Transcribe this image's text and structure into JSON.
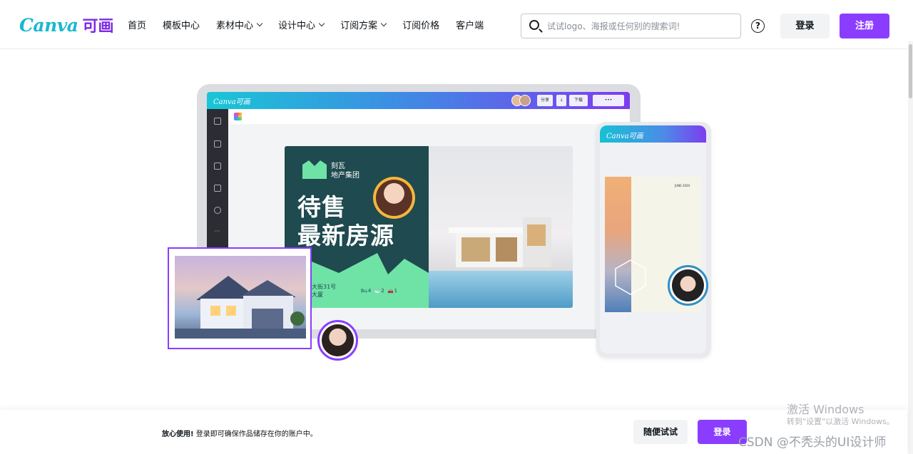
{
  "header": {
    "logo_word": "Canva",
    "logo_cn": "可画",
    "nav": [
      {
        "label": "首页",
        "dropdown": false
      },
      {
        "label": "模板中心",
        "dropdown": false
      },
      {
        "label": "素材中心",
        "dropdown": true
      },
      {
        "label": "设计中心",
        "dropdown": true
      },
      {
        "label": "订阅方案",
        "dropdown": true
      },
      {
        "label": "订阅价格",
        "dropdown": false
      },
      {
        "label": "客户端",
        "dropdown": false
      }
    ],
    "search_placeholder": "试试logo、海报或任何别的搜索词!",
    "help_icon": "?",
    "login_label": "登录",
    "register_label": "注册"
  },
  "hero": {
    "app_logo": "Canva可画",
    "app_buttons": [
      "分享",
      "↓",
      "下载",
      "•••"
    ],
    "design": {
      "brand_line1": "刻瓦",
      "brand_line2": "地产集团",
      "headline": "待售\n最新房源",
      "address": "朝阳大街31号\n万科大厦",
      "specs": "🛏4   🛁2   🚗1"
    },
    "phone_logo": "Canva可画",
    "phone_card_date": "JUNE 2020"
  },
  "bottom_bar": {
    "notice_bold": "放心使用!",
    "notice_text": "登录即可确保作品储存在你的账户中。",
    "try_label": "随便试试",
    "login_label": "登录"
  },
  "watermark": {
    "win_title": "激活 Windows",
    "win_sub": "转到\"设置\"以激活 Windows。",
    "csdn": "CSDN @不秃头的UI设计师"
  },
  "colors": {
    "brand_purple": "#8b3dff",
    "brand_teal": "#19b8d2",
    "design_dark": "#1f4a4f",
    "design_mint": "#6fe3a6"
  }
}
